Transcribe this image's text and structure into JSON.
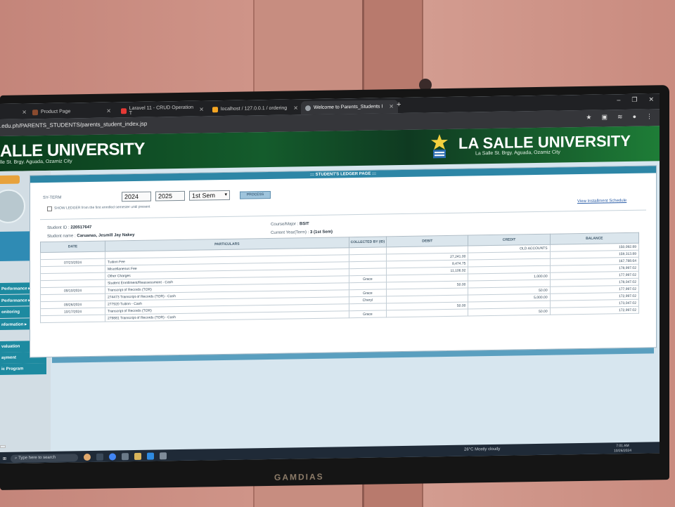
{
  "browser": {
    "tabs": [
      {
        "label": "",
        "color": "#555"
      },
      {
        "label": "Product Page",
        "color": "#8a4b2f"
      },
      {
        "label": "Laravel 11 - CRUD Operation T",
        "color": "#e53935"
      },
      {
        "label": "localhost / 127.0.0.1 / ordering",
        "color": "#f5a623"
      },
      {
        "label": "Welcome to Parents_Students I",
        "color": "#9aa0a6"
      }
    ],
    "url": ".edu.ph/PARENTS_STUDENTS/parents_student_index.jsp",
    "status_url": "",
    "new_tab": "+"
  },
  "header": {
    "left_title": "ALLE UNIVERSITY",
    "left_subtitle": "lle St. Brgy. Aguada, Ozamiz City",
    "right_title": "LA SALLE UNIVERSITY",
    "right_subtitle": "La Salle St. Brgy. Aguada, Ozamiz City"
  },
  "sidebar": {
    "items": [
      {
        "label": "Performance ▸"
      },
      {
        "label": "Performance ▸"
      },
      {
        "label": "onitoring"
      },
      {
        "label": "nformation ▸"
      },
      {
        "label": "valuation"
      },
      {
        "label": "ayment"
      },
      {
        "label": "ic Program"
      }
    ]
  },
  "ledger": {
    "page_title": "::: STUDENT'S LEDGER PAGE :::",
    "sy_label": "SY-TERM",
    "year_from": "2024",
    "year_to": "2025",
    "sem": "1st Sem",
    "process_label": "PROCESS",
    "show_all_label": "SHOW LEDGER from the first enrolled semester until present",
    "installment_link": "View Installment Schedule",
    "student_id_label": "Student ID :",
    "student_id": "220517647",
    "student_name_label": "Student name :",
    "student_name": "Caruanas, Jesmill Jay Nakey",
    "course_label": "Course/Major :",
    "course": "BSIT",
    "term_label": "Current Year(Term) :",
    "term": "3 (1st Sem)",
    "columns": [
      "DATE",
      "PARTICULARS",
      "COLLECTED BY (ID)",
      "DEBIT",
      "CREDIT",
      "BALANCE"
    ],
    "rows": [
      {
        "date": "",
        "particulars": "",
        "collected": "",
        "debit": "",
        "credit": "OLD ACCOUNTS",
        "balance": "150,092.89"
      },
      {
        "date": "07/23/2024",
        "particulars": "Tuition Fee",
        "collected": "",
        "debit": "27,241.00",
        "credit": "",
        "balance": "159,313.89"
      },
      {
        "date": "",
        "particulars": "Miscellaneous Fee",
        "collected": "",
        "debit": "8,474.75",
        "credit": "",
        "balance": "167,788.64"
      },
      {
        "date": "",
        "particulars": "Other Charges",
        "collected": "",
        "debit": "11,106.92",
        "credit": "",
        "balance": "178,997.02"
      },
      {
        "date": "",
        "particulars": "  Student Enrollment/Reassessment - Cash",
        "collected": "Grace",
        "debit": "",
        "credit": "1,000.00",
        "balance": "177,997.02"
      },
      {
        "date": "09/10/2024",
        "particulars": "Transcript of Records (TOR)",
        "collected": "",
        "debit": "50.00",
        "credit": "",
        "balance": "178,047.02"
      },
      {
        "date": "",
        "particulars": "   274473 Transcript of Records (TOR) - Cash",
        "collected": "Grace",
        "debit": "",
        "credit": "50.00",
        "balance": "177,997.02"
      },
      {
        "date": "09/26/2024",
        "particulars": "   277920 Tuition - Cash",
        "collected": "Cheryl",
        "debit": "",
        "credit": "5,000.00",
        "balance": "172,997.02"
      },
      {
        "date": "10/17/2024",
        "particulars": "Transcript of Records (TOR)",
        "collected": "",
        "debit": "50.00",
        "credit": "",
        "balance": "173,047.02"
      },
      {
        "date": "",
        "particulars": "   279881 Transcript of Records (TOR) - Cash",
        "collected": "Grace",
        "debit": "",
        "credit": "50.00",
        "balance": "172,997.02"
      }
    ]
  },
  "taskbar": {
    "search_placeholder": "Type here to search",
    "weather": "26°C  Mostly cloudy",
    "time": "7:01 AM",
    "date": "10/26/2024"
  },
  "monitor": {
    "brand": "GAMDIAS"
  },
  "colors": {
    "header_green": "#145c2c",
    "panel_blue": "#2d86a6",
    "sidebar_teal": "#1d8aa0",
    "accent_orange": "#e7a23c"
  }
}
